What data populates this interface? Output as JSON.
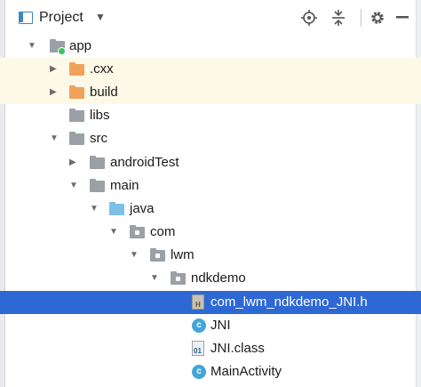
{
  "header": {
    "title": "Project",
    "dropdown_icon": "chevron-down-icon",
    "tools": [
      "locate-icon",
      "collapse-all-icon",
      "gear-icon",
      "hide-icon"
    ]
  },
  "tree": {
    "items": [
      {
        "label": "app",
        "icon": "module-folder-icon",
        "expanded": true
      },
      {
        "label": ".cxx",
        "icon": "orange-folder-icon",
        "expanded": false
      },
      {
        "label": "build",
        "icon": "orange-folder-icon",
        "expanded": false
      },
      {
        "label": "libs",
        "icon": "folder-icon"
      },
      {
        "label": "src",
        "icon": "folder-icon",
        "expanded": true
      },
      {
        "label": "androidTest",
        "icon": "folder-icon",
        "expanded": false
      },
      {
        "label": "main",
        "icon": "folder-icon",
        "expanded": true
      },
      {
        "label": "java",
        "icon": "source-folder-icon",
        "expanded": true
      },
      {
        "label": "com",
        "icon": "package-icon",
        "expanded": true
      },
      {
        "label": "lwm",
        "icon": "package-icon",
        "expanded": true
      },
      {
        "label": "ndkdemo",
        "icon": "package-icon",
        "expanded": true
      },
      {
        "label": "com_lwm_ndkdemo_JNI.h",
        "icon": "header-file-icon",
        "selected": true
      },
      {
        "label": "JNI",
        "icon": "class-icon"
      },
      {
        "label": "JNI.class",
        "icon": "class-file-icon"
      },
      {
        "label": "MainActivity",
        "icon": "class-icon"
      }
    ]
  },
  "colors": {
    "selection": "#2e68d4",
    "ignored_highlight": "#fcf9e6",
    "orange_folder": "#f0a25a",
    "gray_folder": "#9aa0a6",
    "source_folder": "#7cc0e8",
    "class_badge": "#44a5d8"
  }
}
